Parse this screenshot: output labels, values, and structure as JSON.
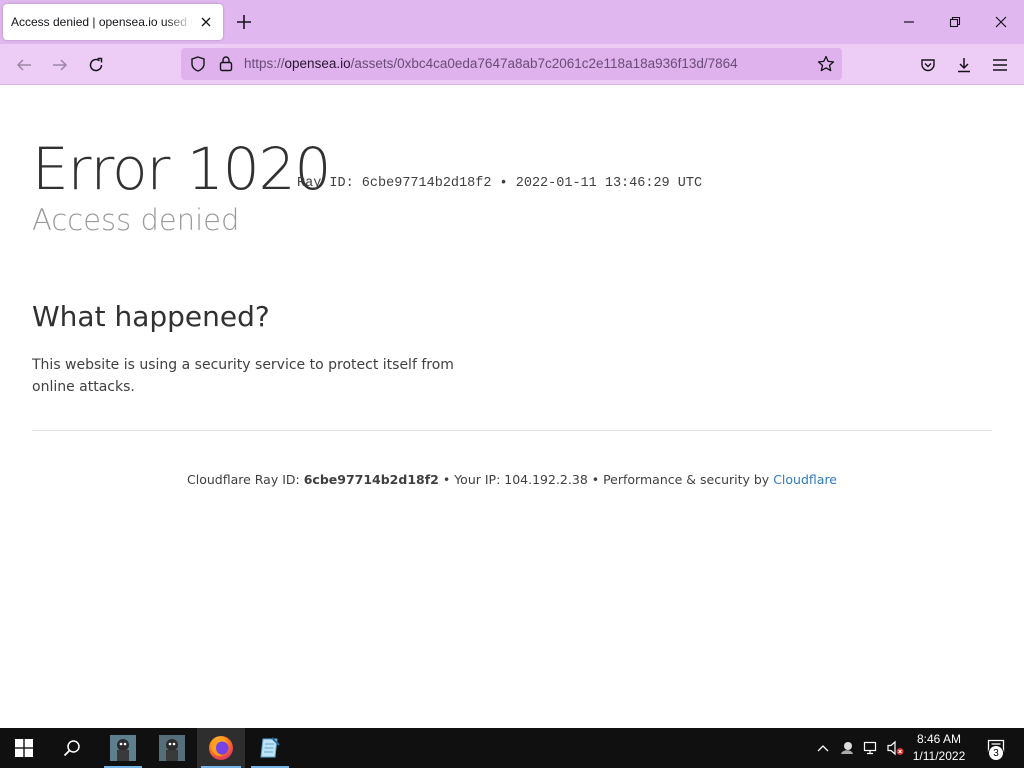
{
  "browser": {
    "tab_title": "Access denied | opensea.io used Cloudflare to restrict access",
    "url_prefix": "https://",
    "url_host": "opensea.io",
    "url_path": "/assets/0xbc4ca0eda7647a8ab7c2061c2e118a18a936f13d/7864",
    "theme_colors": {
      "titlebar": "#e0b7ee",
      "navbar": "#edcdf6",
      "urlbar": "#dfb1ed"
    }
  },
  "page": {
    "error_title": "Error 1020",
    "ray_id_line": "Ray ID: 6cbe97714b2d18f2 • 2022-01-11 13:46:29 UTC",
    "subtitle": "Access denied",
    "section_heading": "What happened?",
    "explanation": "This website is using a security service to protect itself from online attacks.",
    "footer": {
      "ray_label": "Cloudflare Ray ID:",
      "ray_value": "6cbe97714b2d18f2",
      "ip_text": "• Your IP: 104.192.2.38 • Performance & security by",
      "link": "Cloudflare"
    }
  },
  "taskbar": {
    "time": "8:46 AM",
    "date": "1/11/2022",
    "notification_count": "3",
    "icons": [
      "windows-start-icon",
      "search-icon",
      "app-icon-1",
      "app-icon-2",
      "firefox-icon",
      "notepad-icon"
    ]
  }
}
